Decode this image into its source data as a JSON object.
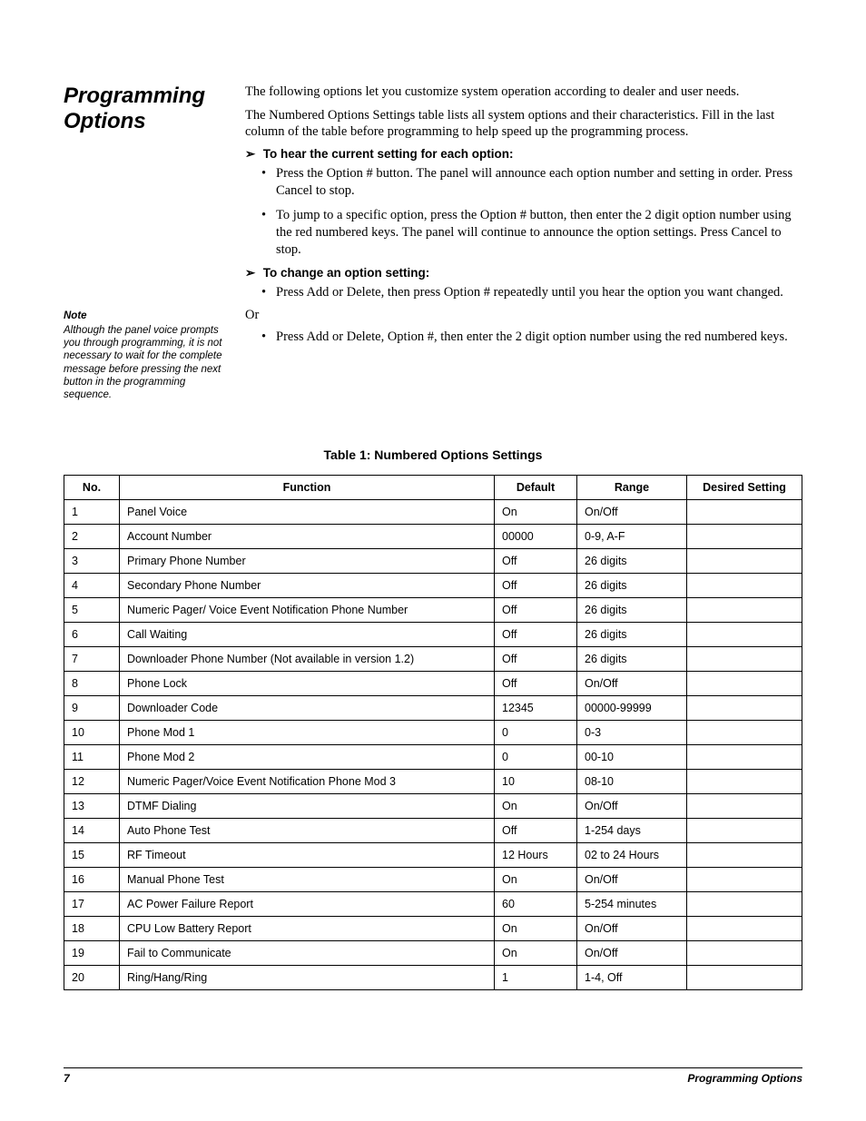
{
  "section_title": "Programming Options",
  "intro": {
    "p1": "The following options let you customize system operation according to dealer and user needs.",
    "p2": "The Numbered Options Settings table lists all system options and their characteristics. Fill in the last column of the table before programming to help speed up the programming process."
  },
  "hear_heading": "To hear the current setting for each option:",
  "hear_bullets": [
    "Press the Option # button. The panel will announce each option number and setting in order. Press Cancel to stop.",
    "To jump to a specific option, press the Option # button, then enter the 2 digit option number using the red numbered keys. The panel will continue to announce the option settings. Press Cancel to stop."
  ],
  "change_heading": "To change an option setting:",
  "change_bullets_1": [
    "Press Add or Delete, then press Option # repeatedly until you hear the option you want changed."
  ],
  "or_text": "Or",
  "change_bullets_2": [
    "Press Add or Delete, Option #, then enter the 2 digit option number using the red numbered keys."
  ],
  "note": {
    "label": "Note",
    "body": "Although the panel voice prompts you through programming, it is not necessary to wait for the complete message before pressing the next button in the programming sequence."
  },
  "table_title": "Table 1: Numbered Options Settings",
  "headers": {
    "no": "No.",
    "function": "Function",
    "default": "Default",
    "range": "Range",
    "desired": "Desired Setting"
  },
  "rows": [
    {
      "no": "1",
      "fn": "Panel Voice",
      "def": "On",
      "rng": "On/Off",
      "des": ""
    },
    {
      "no": "2",
      "fn": "Account Number",
      "def": "00000",
      "rng": "0-9, A-F",
      "des": ""
    },
    {
      "no": "3",
      "fn": "Primary Phone Number",
      "def": "Off",
      "rng": "26 digits",
      "des": ""
    },
    {
      "no": "4",
      "fn": "Secondary Phone Number",
      "def": "Off",
      "rng": "26 digits",
      "des": ""
    },
    {
      "no": "5",
      "fn": "Numeric Pager/ Voice Event Notification Phone Number",
      "def": "Off",
      "rng": "26 digits",
      "des": ""
    },
    {
      "no": "6",
      "fn": "Call Waiting",
      "def": "Off",
      "rng": "26 digits",
      "des": ""
    },
    {
      "no": "7",
      "fn": "Downloader Phone Number (Not available in version 1.2)",
      "def": "Off",
      "rng": "26 digits",
      "des": ""
    },
    {
      "no": "8",
      "fn": "Phone Lock",
      "def": "Off",
      "rng": "On/Off",
      "des": ""
    },
    {
      "no": "9",
      "fn": "Downloader Code",
      "def": "12345",
      "rng": "00000-99999",
      "des": ""
    },
    {
      "no": "10",
      "fn": "Phone Mod 1",
      "def": "0",
      "rng": "0-3",
      "des": ""
    },
    {
      "no": "11",
      "fn": "Phone Mod 2",
      "def": "0",
      "rng": "00-10",
      "des": ""
    },
    {
      "no": "12",
      "fn": "Numeric Pager/Voice Event Notification Phone Mod 3",
      "def": "10",
      "rng": "08-10",
      "des": ""
    },
    {
      "no": "13",
      "fn": "DTMF Dialing",
      "def": "On",
      "rng": "On/Off",
      "des": ""
    },
    {
      "no": "14",
      "fn": "Auto Phone Test",
      "def": "Off",
      "rng": "1-254 days",
      "des": ""
    },
    {
      "no": "15",
      "fn": "RF Timeout",
      "def": "12 Hours",
      "rng": "02 to 24 Hours",
      "des": ""
    },
    {
      "no": "16",
      "fn": "Manual Phone Test",
      "def": "On",
      "rng": "On/Off",
      "des": ""
    },
    {
      "no": "17",
      "fn": "AC Power Failure Report",
      "def": "60",
      "rng": "5-254 minutes",
      "des": ""
    },
    {
      "no": "18",
      "fn": "CPU Low Battery Report",
      "def": "On",
      "rng": "On/Off",
      "des": ""
    },
    {
      "no": "19",
      "fn": "Fail to Communicate",
      "def": "On",
      "rng": "On/Off",
      "des": ""
    },
    {
      "no": "20",
      "fn": "Ring/Hang/Ring",
      "def": "1",
      "rng": "1-4, Off",
      "des": ""
    }
  ],
  "footer": {
    "page_no": "7",
    "section": "Programming Options"
  },
  "chart_data": {
    "type": "table",
    "title": "Table 1: Numbered Options Settings",
    "columns": [
      "No.",
      "Function",
      "Default",
      "Range",
      "Desired Setting"
    ],
    "rows": [
      [
        "1",
        "Panel Voice",
        "On",
        "On/Off",
        ""
      ],
      [
        "2",
        "Account Number",
        "00000",
        "0-9, A-F",
        ""
      ],
      [
        "3",
        "Primary Phone Number",
        "Off",
        "26 digits",
        ""
      ],
      [
        "4",
        "Secondary Phone Number",
        "Off",
        "26 digits",
        ""
      ],
      [
        "5",
        "Numeric Pager/ Voice Event Notification Phone Number",
        "Off",
        "26 digits",
        ""
      ],
      [
        "6",
        "Call Waiting",
        "Off",
        "26 digits",
        ""
      ],
      [
        "7",
        "Downloader Phone Number (Not available in version 1.2)",
        "Off",
        "26 digits",
        ""
      ],
      [
        "8",
        "Phone Lock",
        "Off",
        "On/Off",
        ""
      ],
      [
        "9",
        "Downloader Code",
        "12345",
        "00000-99999",
        ""
      ],
      [
        "10",
        "Phone Mod 1",
        "0",
        "0-3",
        ""
      ],
      [
        "11",
        "Phone Mod 2",
        "0",
        "00-10",
        ""
      ],
      [
        "12",
        "Numeric Pager/Voice Event Notification Phone Mod 3",
        "10",
        "08-10",
        ""
      ],
      [
        "13",
        "DTMF Dialing",
        "On",
        "On/Off",
        ""
      ],
      [
        "14",
        "Auto Phone Test",
        "Off",
        "1-254 days",
        ""
      ],
      [
        "15",
        "RF Timeout",
        "12 Hours",
        "02 to 24 Hours",
        ""
      ],
      [
        "16",
        "Manual Phone Test",
        "On",
        "On/Off",
        ""
      ],
      [
        "17",
        "AC Power Failure Report",
        "60",
        "5-254 minutes",
        ""
      ],
      [
        "18",
        "CPU Low Battery Report",
        "On",
        "On/Off",
        ""
      ],
      [
        "19",
        "Fail to Communicate",
        "On",
        "On/Off",
        ""
      ],
      [
        "20",
        "Ring/Hang/Ring",
        "1",
        "1-4, Off",
        ""
      ]
    ]
  }
}
